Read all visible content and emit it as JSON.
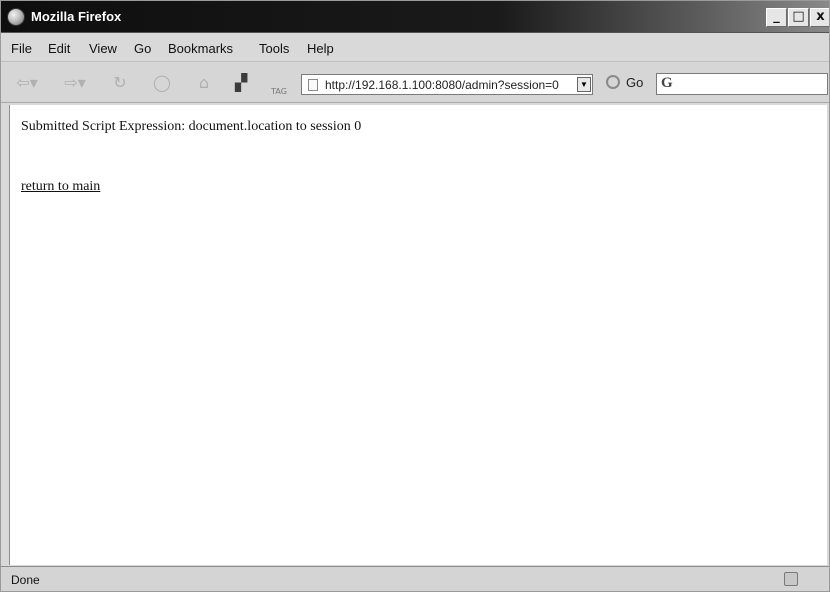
{
  "window": {
    "title": "Mozilla Firefox",
    "buttons": {
      "minimize": "_",
      "maximize": "□",
      "close": "x"
    }
  },
  "menubar": {
    "items": [
      {
        "label": "File"
      },
      {
        "label": "Edit"
      },
      {
        "label": "View"
      },
      {
        "label": "Go"
      },
      {
        "label": "Bookmarks"
      },
      {
        "label": "Tools"
      },
      {
        "label": "Help"
      }
    ]
  },
  "toolbar": {
    "icons": {
      "back": "back-icon",
      "forward": "forward-icon",
      "reload": "reload-icon",
      "stop": "stop-icon",
      "home": "home-icon",
      "bookmark": "bookmark-icon"
    },
    "tag_label": "TAG",
    "address": "http://192.168.1.100:8080/admin?session=0",
    "go_label": "Go",
    "search_engine": "G"
  },
  "page": {
    "submitted_text": "Submitted Script Expression: document.location to session 0",
    "return_link": "return to main"
  },
  "status": {
    "text": "Done"
  }
}
